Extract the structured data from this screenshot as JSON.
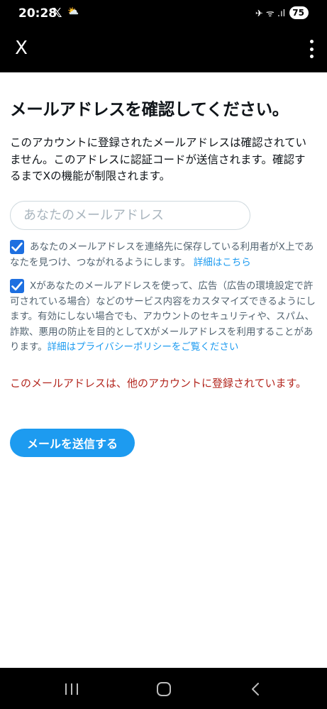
{
  "status_bar": {
    "time": "20:28",
    "x_glyph": "𝕏",
    "weather": "⛅",
    "signal": "✈ ᯤ .ıl",
    "battery": "75"
  },
  "app_bar": {
    "close_glyph": "X"
  },
  "screen": {
    "title": "メールアドレスを確認してください。",
    "description": "このアカウントに登録されたメールアドレスは確認されていません。このアドレスに認証コードが送信されます。確認するまでXの機能が制限されます。",
    "email_placeholder": "あなたのメールアドレス",
    "email_value": "",
    "checkbox_1": {
      "checked": true,
      "text": "あなたのメールアドレスを連絡先に保存している利用者がX上であなたを見つけ、つながれるようにします。",
      "link": "詳細はこちら"
    },
    "checkbox_2": {
      "checked": true,
      "text": "Xがあなたのメールアドレスを使って、広告（広告の環境設定で許可されている場合）などのサービス内容をカスタマイズできるようにします。有効にしない場合でも、アカウントのセキュリティや、スパム、詐欺、悪用の防止を目的としてXがメールアドレスを利用することがあります。",
      "link": "詳細はプライバシーポリシーをご覧ください"
    },
    "error": "このメールアドレスは、他のアカウントに登録されています。",
    "send_button": "メールを送信する"
  },
  "colors": {
    "accent": "#1d9bf0",
    "checkbox": "#1d6fe0",
    "error": "#b3261e",
    "muted_text": "#536471"
  },
  "icons": [
    "x-logo-icon",
    "weather-icon",
    "mute-icon",
    "wifi-icon",
    "signal-icon",
    "battery-icon",
    "close-icon",
    "more-vert-icon",
    "check-icon",
    "recents-icon",
    "home-icon",
    "back-icon"
  ]
}
